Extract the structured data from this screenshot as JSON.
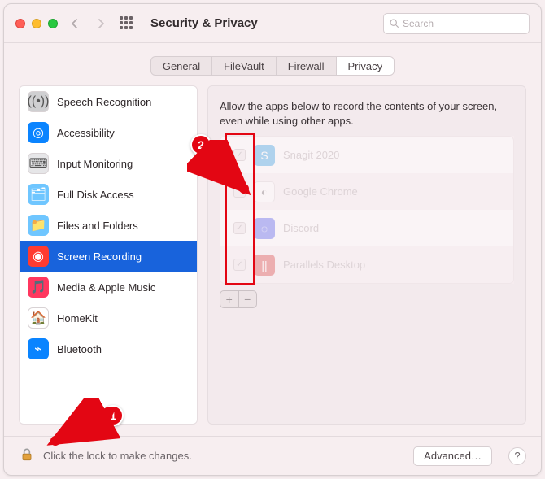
{
  "window": {
    "title": "Security & Privacy",
    "search_placeholder": "Search"
  },
  "tabs": {
    "items": [
      {
        "label": "General"
      },
      {
        "label": "FileVault"
      },
      {
        "label": "Firewall"
      },
      {
        "label": "Privacy"
      }
    ],
    "active_index": 3
  },
  "sidebar": {
    "items": [
      {
        "label": "Speech Recognition",
        "icon_bg": "#cfcfd1",
        "glyph": "((•))"
      },
      {
        "label": "Accessibility",
        "icon_bg": "#0a84ff",
        "glyph": "◎"
      },
      {
        "label": "Input Monitoring",
        "icon_bg": "#e6e6e8",
        "glyph": "⌨︎"
      },
      {
        "label": "Full Disk Access",
        "icon_bg": "#6fc6ff",
        "glyph": "🗂"
      },
      {
        "label": "Files and Folders",
        "icon_bg": "#6fc6ff",
        "glyph": "📁"
      },
      {
        "label": "Screen Recording",
        "icon_bg": "#ff3b30",
        "glyph": "◉"
      },
      {
        "label": "Media & Apple Music",
        "icon_bg": "#ff375f",
        "glyph": "🎵"
      },
      {
        "label": "HomeKit",
        "icon_bg": "#ffffff",
        "glyph": "🏠"
      },
      {
        "label": "Bluetooth",
        "icon_bg": "#0a84ff",
        "glyph": "⌁"
      }
    ],
    "selected_index": 5
  },
  "panel": {
    "description": "Allow the apps below to record the contents of your screen, even while using other apps.",
    "apps": [
      {
        "label": "Snagit 2020",
        "checked": true,
        "icon_bg": "#3aa7e6",
        "glyph": "S"
      },
      {
        "label": "Google Chrome",
        "checked": false,
        "icon_bg": "#ffffff",
        "glyph": "◐"
      },
      {
        "label": "Discord",
        "checked": true,
        "icon_bg": "#5865f2",
        "glyph": "◌"
      },
      {
        "label": "Parallels Desktop",
        "checked": true,
        "icon_bg": "#d94949",
        "glyph": "||"
      }
    ],
    "add_label": "+",
    "remove_label": "−"
  },
  "footer": {
    "lock_text": "Click the lock to make changes.",
    "advanced_label": "Advanced…",
    "help_label": "?"
  },
  "annotations": {
    "badge1": "1",
    "badge2": "2"
  }
}
